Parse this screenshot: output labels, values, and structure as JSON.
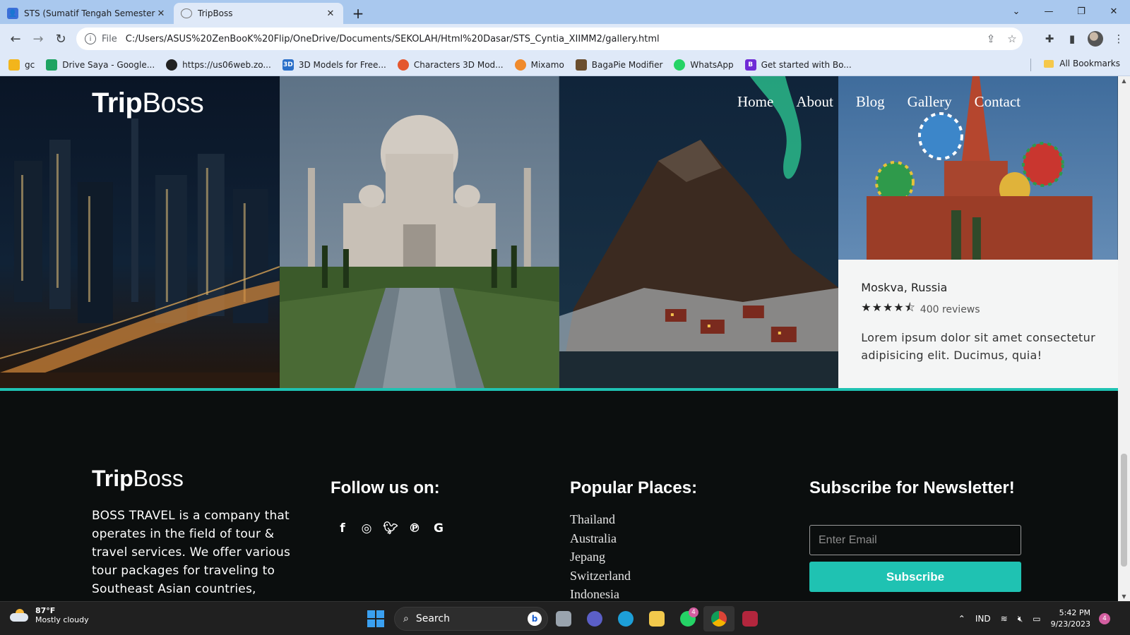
{
  "browser": {
    "tabs": [
      {
        "title": "STS (Sumatif Tengah Semester) C",
        "active": false
      },
      {
        "title": "TripBoss",
        "active": true
      }
    ],
    "scheme": "File",
    "url": "C:/Users/ASUS%20ZenBooK%20Flip/OneDrive/Documents/SEKOLAH/Html%20Dasar/STS_Cyntia_XIIMM2/gallery.html",
    "bookmarks": [
      {
        "label": "gc",
        "color": "#f2b51c"
      },
      {
        "label": "Drive Saya - Google...",
        "color": "#1ea362"
      },
      {
        "label": "https://us06web.zo...",
        "color": "#222222"
      },
      {
        "label": "3D Models for Free...",
        "color": "#2a6fc9"
      },
      {
        "label": "Characters 3D Mod...",
        "color": "#e4572e"
      },
      {
        "label": "Mixamo",
        "color": "#f08a2c"
      },
      {
        "label": "BagaPie Modifier",
        "color": "#6b4e2e"
      },
      {
        "label": "WhatsApp",
        "color": "#25d366"
      },
      {
        "label": "Get started with Bo...",
        "color": "#6f2bd6"
      }
    ],
    "all_bookmarks": "All Bookmarks"
  },
  "site": {
    "brand_bold": "Trip",
    "brand_light": "Boss",
    "nav": [
      "Home",
      "About",
      "Blog",
      "Gallery",
      "Contact"
    ],
    "card": {
      "place": "Moskva, Russia",
      "stars": "★★★★⯪",
      "rating": 4.5,
      "reviews": "400 reviews",
      "description": "Lorem ipsum dolor sit amet consectetur adipisicing elit. Ducimus, quia!"
    },
    "accent_color": "#1fc2b2"
  },
  "footer": {
    "brand_bold": "Trip",
    "brand_light": "Boss",
    "about": "BOSS TRAVEL is a company that operates in the field of tour & travel services. We offer various tour packages for traveling to Southeast Asian countries, including Malaysia",
    "follow_heading": "Follow us on:",
    "social_icons": [
      "facebook-icon",
      "instagram-icon",
      "twitter-icon",
      "pinterest-icon",
      "google-plus-icon"
    ],
    "places_heading": "Popular Places:",
    "places": [
      "Thailand",
      "Australia",
      "Jepang",
      "Switzerland",
      "Indonesia"
    ],
    "newsletter_heading": "Subscribe for Newsletter!",
    "email_placeholder": "Enter Email",
    "subscribe_label": "Subscribe"
  },
  "taskbar": {
    "temperature": "87°F",
    "weather": "Mostly cloudy",
    "search_label": "Search",
    "language": "IND",
    "time": "5:42 PM",
    "date": "9/23/2023",
    "whatsapp_badge": "4",
    "notification_count": "4"
  }
}
